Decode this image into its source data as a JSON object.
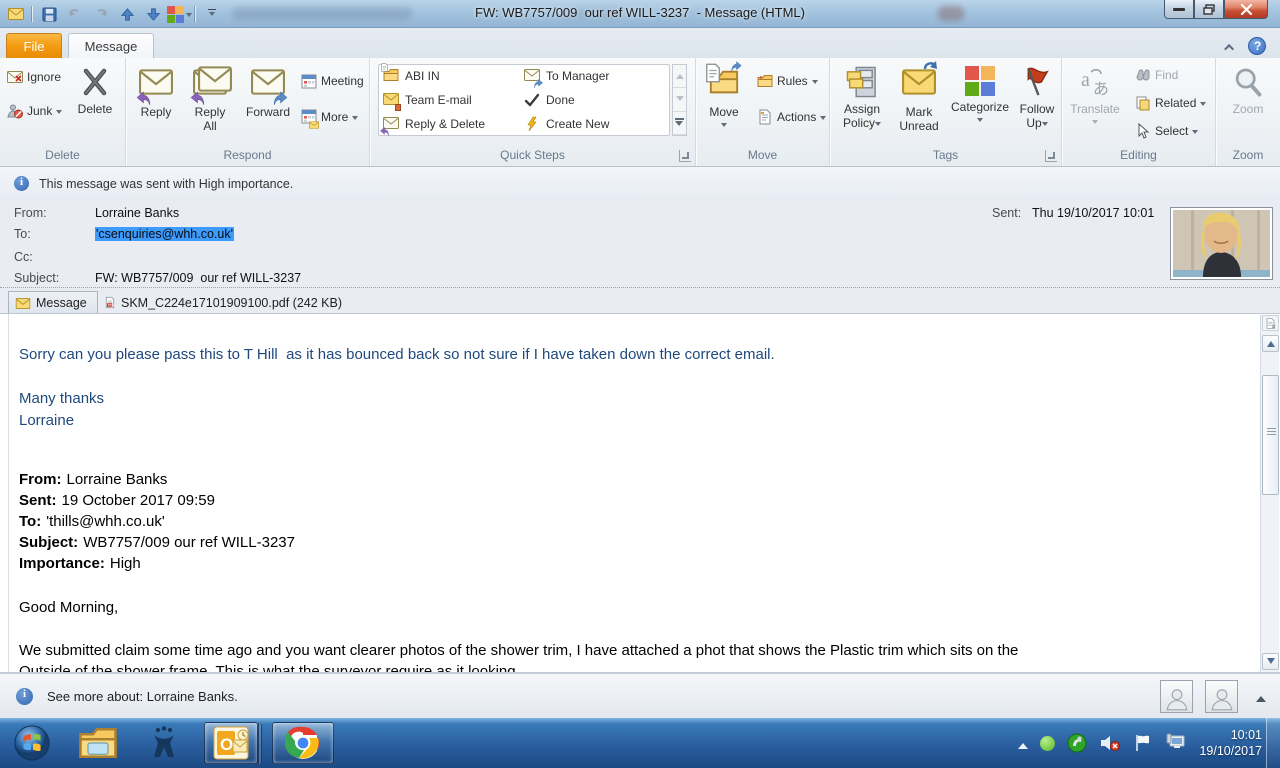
{
  "titlebar": {
    "title": "FW: WB7757/009  our ref WILL-3237  - Message (HTML)"
  },
  "tabs": {
    "file": "File",
    "message": "Message"
  },
  "ribbon": {
    "delete": {
      "label": "Delete",
      "ignore": "Ignore",
      "junk": "Junk",
      "del": "Delete"
    },
    "respond": {
      "label": "Respond",
      "reply": "Reply",
      "reply_all_1": "Reply",
      "reply_all_2": "All",
      "forward": "Forward",
      "meeting": "Meeting",
      "more": "More"
    },
    "quick_steps": {
      "label": "Quick Steps",
      "items": [
        "ABI IN",
        "Team E-mail",
        "Reply & Delete",
        "To Manager",
        "Done",
        "Create New"
      ]
    },
    "move": {
      "label": "Move",
      "move": "Move",
      "rules": "Rules",
      "actions": "Actions"
    },
    "tags": {
      "label": "Tags",
      "assign_1": "Assign",
      "assign_2": "Policy",
      "mark_1": "Mark",
      "mark_2": "Unread",
      "categorize": "Categorize",
      "follow_1": "Follow",
      "follow_2": "Up"
    },
    "editing": {
      "label": "Editing",
      "translate": "Translate",
      "find": "Find",
      "related": "Related",
      "select": "Select"
    },
    "zoomgrp": {
      "label": "Zoom",
      "zoom": "Zoom"
    }
  },
  "infobar": {
    "text": "This message was sent with High importance."
  },
  "header": {
    "from_label": "From:",
    "from_value": "Lorraine Banks",
    "to_label": "To:",
    "to_value": "'csenquiries@whh.co.uk'",
    "cc_label": "Cc:",
    "subject_label": "Subject:",
    "subject_value": "FW: WB7757/009  our ref WILL-3237",
    "sent_label": "Sent:",
    "sent_value": "Thu 19/10/2017 10:01"
  },
  "attachment_bar": {
    "message_tab": "Message",
    "attachment_name": "SKM_C224e17101909100.pdf (242 KB)"
  },
  "body": {
    "line1": "Sorry can you please pass this to T Hill  as it has bounced back so not sure if I have taken down the correct email.",
    "thanks": "Many thanks",
    "signature": "Lorraine",
    "q_from_label": "From:",
    "q_from": "Lorraine Banks",
    "q_sent_label": "Sent:",
    "q_sent": "19 October 2017 09:59",
    "q_to_label": "To:",
    "q_to": "'thills@whh.co.uk'",
    "q_subject_label": "Subject:",
    "q_subject": "WB7757/009 our ref WILL-3237",
    "q_importance_label": "Importance:",
    "q_importance": "High",
    "greeting": "Good Morning,",
    "para1": "We submitted claim some time ago and you want clearer photos of the shower trim, I have attached a phot that shows the Plastic trim which sits on the",
    "para2": "Outside of the shower frame. This is what the surveyor require as it looking"
  },
  "people_pane": {
    "text": "See more about: Lorraine Banks."
  },
  "taskbar": {
    "time": "10:01",
    "date": "19/10/2017"
  },
  "colors": {
    "selection_highlight": "#3d9bfd",
    "reply_text_blue": "#1F497D",
    "file_tab_orange": "#F39C12",
    "flag_red": "#C43E1C",
    "categorize_squares": [
      "#E2574C",
      "#F4B459",
      "#60A917",
      "#5B7DD8"
    ]
  }
}
